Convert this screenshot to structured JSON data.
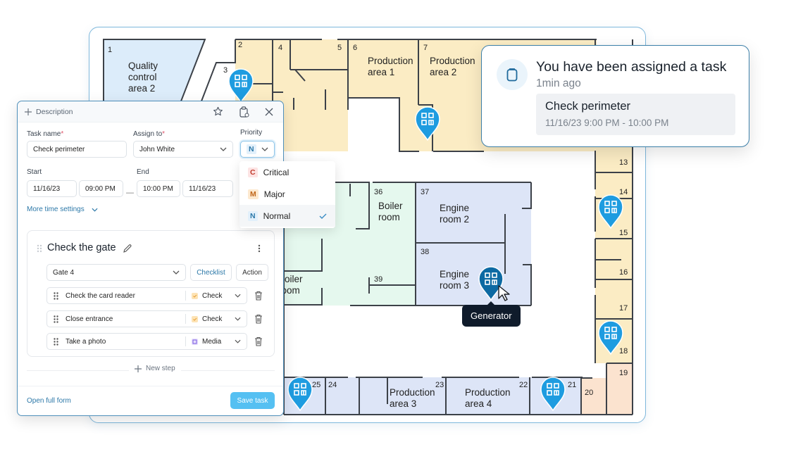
{
  "colors": {
    "accent": "#2c78a8",
    "pin": "#1e9ce0",
    "pin_active": "#0d6aa3",
    "room_yellow": "#fbecc4",
    "room_blue_light": "#dcecfa",
    "room_blue": "#dde5f7",
    "room_green": "#e5f8ee",
    "room_peach": "#fbe3cf",
    "save_button": "#55c0f2"
  },
  "map": {
    "rooms": [
      {
        "num": "1",
        "name": "Quality\ncontrol\narea 2"
      },
      {
        "num": "2",
        "name": ""
      },
      {
        "num": "3",
        "name": ""
      },
      {
        "num": "4",
        "name": ""
      },
      {
        "num": "5",
        "name": ""
      },
      {
        "num": "6",
        "name": "Production\narea 1"
      },
      {
        "num": "7",
        "name": "Production\narea 2"
      },
      {
        "num": "13",
        "name": ""
      },
      {
        "num": "14",
        "name": ""
      },
      {
        "num": "15",
        "name": ""
      },
      {
        "num": "16",
        "name": ""
      },
      {
        "num": "17",
        "name": ""
      },
      {
        "num": "18",
        "name": ""
      },
      {
        "num": "19",
        "name": ""
      },
      {
        "num": "20",
        "name": ""
      },
      {
        "num": "21",
        "name": ""
      },
      {
        "num": "22",
        "name": "Production\narea 4"
      },
      {
        "num": "23",
        "name": "Production\narea 3"
      },
      {
        "num": "24",
        "name": ""
      },
      {
        "num": "25",
        "name": ""
      },
      {
        "num": "36",
        "name": "Boiler\nroom"
      },
      {
        "num": "37",
        "name": "Engine\nroom 2"
      },
      {
        "num": "38",
        "name": "Engine\nroom 3"
      },
      {
        "num": "39",
        "name": ""
      },
      {
        "num": "",
        "name": "Boiler\nroom"
      }
    ],
    "pin_icon": "qr-code-icon",
    "tooltip": "Generator"
  },
  "form": {
    "description_label": "Description",
    "icons": [
      "star-icon",
      "clipboard-icon",
      "close-icon"
    ],
    "task_name_label": "Task name",
    "task_name_value": "Check perimeter",
    "assign_label": "Assign to",
    "assign_value": "John White",
    "priority_label": "Priority",
    "priority_value": "N",
    "start_label": "Start",
    "start_date": "11/16/23",
    "start_time": "09:00 PM",
    "end_label": "End",
    "end_time": "10:00 PM",
    "end_date": "11/16/23",
    "dash": "—",
    "more_time": "More time settings",
    "step": {
      "title": "Check the gate",
      "location": "Gate 4",
      "checklist_label": "Checklist",
      "action_label": "Action",
      "items": [
        {
          "text": "Check the card reader",
          "type": "Check"
        },
        {
          "text": "Close entrance",
          "type": "Check"
        },
        {
          "text": "Take a photo",
          "type": "Media"
        }
      ]
    },
    "new_step": "New step",
    "open_full_form": "Open full form",
    "save_task": "Save task"
  },
  "priority_menu": {
    "options": [
      {
        "badge": "C",
        "label": "Critical",
        "color": "#c0392b",
        "bg": "#fde4e4"
      },
      {
        "badge": "M",
        "label": "Major",
        "color": "#c0661a",
        "bg": "#fde9cf"
      },
      {
        "badge": "N",
        "label": "Normal",
        "color": "#2c78a8",
        "bg": "#e2f0fb"
      }
    ],
    "selected": "Normal"
  },
  "notification": {
    "title": "You have been assigned a task",
    "time": "1min ago",
    "task_name": "Check perimeter",
    "task_time": "11/16/23 9:00 PM - 10:00 PM"
  }
}
